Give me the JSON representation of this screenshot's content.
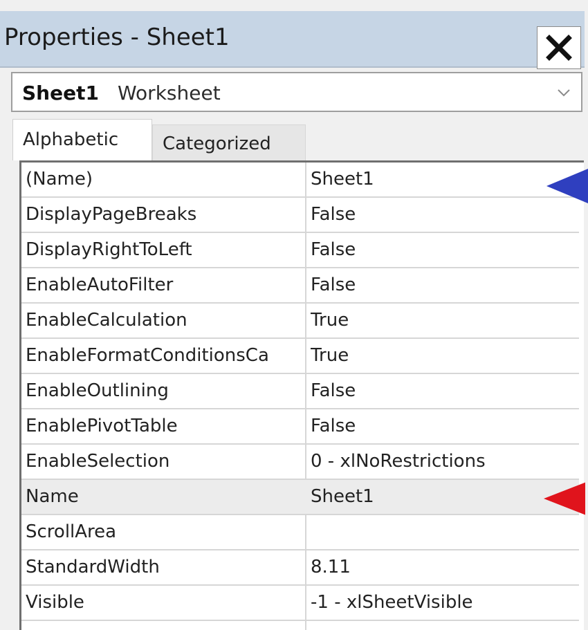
{
  "window": {
    "title": "Properties - Sheet1",
    "close_icon": "close-icon"
  },
  "object_selector": {
    "name": "Sheet1",
    "type": "Worksheet",
    "dropdown_icon": "chevron-down-icon"
  },
  "tabs": [
    {
      "label": "Alphabetic",
      "active": true
    },
    {
      "label": "Categorized",
      "active": false
    }
  ],
  "properties": [
    {
      "name": "(Name)",
      "value": "Sheet1"
    },
    {
      "name": "DisplayPageBreaks",
      "value": "False"
    },
    {
      "name": "DisplayRightToLeft",
      "value": "False"
    },
    {
      "name": "EnableAutoFilter",
      "value": "False"
    },
    {
      "name": "EnableCalculation",
      "value": "True"
    },
    {
      "name": "EnableFormatConditionsCa",
      "value": "True"
    },
    {
      "name": "EnableOutlining",
      "value": "False"
    },
    {
      "name": "EnablePivotTable",
      "value": "False"
    },
    {
      "name": "EnableSelection",
      "value": "0 - xlNoRestrictions"
    },
    {
      "name": "Name",
      "value": "Sheet1"
    },
    {
      "name": "ScrollArea",
      "value": ""
    },
    {
      "name": "StandardWidth",
      "value": "8.11"
    },
    {
      "name": "Visible",
      "value": "-1 - xlSheetVisible"
    }
  ],
  "annotations": {
    "blue_arrow_color": "#2f3fbf",
    "red_arrow_color": "#e0141c"
  }
}
